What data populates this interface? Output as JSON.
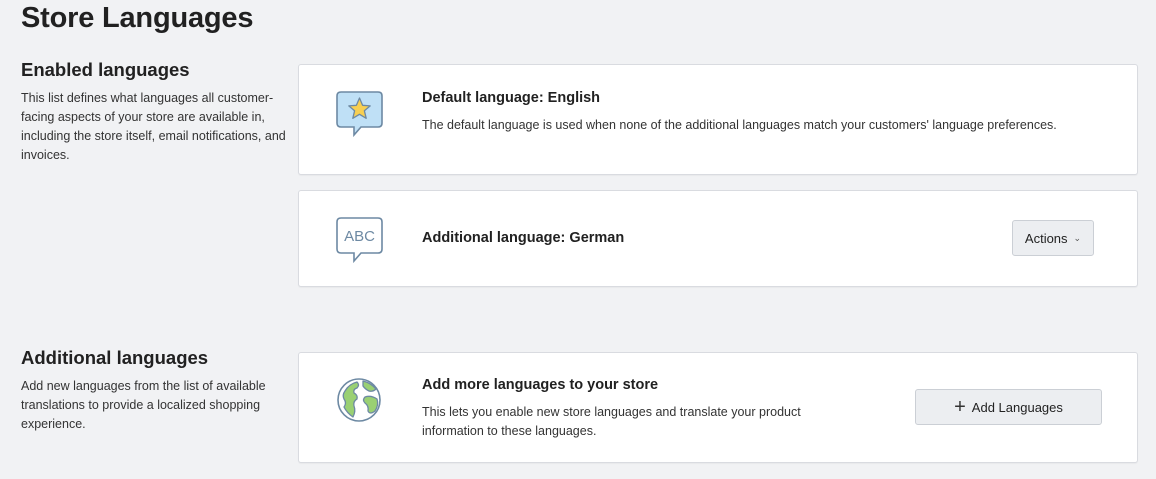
{
  "page": {
    "title": "Store Languages"
  },
  "enabled_section": {
    "heading": "Enabled languages",
    "description": "This list defines what languages all customer-facing aspects of your store are available in, including the store itself, email notifications, and invoices."
  },
  "default_card": {
    "icon": "speech-bubble-star-icon",
    "title": "Default language: English",
    "description": "The default language is used when none of the additional languages match your customers' language preferences."
  },
  "additional_card": {
    "icon": "speech-bubble-abc-icon",
    "icon_text": "ABC",
    "title": "Additional language: German",
    "actions_label": "Actions"
  },
  "additional_section": {
    "heading": "Additional languages",
    "description": "Add new languages from the list of available translations to provide a localized shopping experience."
  },
  "add_card": {
    "icon": "globe-icon",
    "title": "Add more languages to your store",
    "description": "This lets you enable new store languages and translate your product information to these languages.",
    "button_label": "Add Languages"
  },
  "colors": {
    "background": "#f1f2f4",
    "icon_bubble_fill": "#bfe0f6",
    "icon_stroke": "#6d89a3",
    "star": "#f7cf52",
    "globe_land": "#9ad073"
  }
}
